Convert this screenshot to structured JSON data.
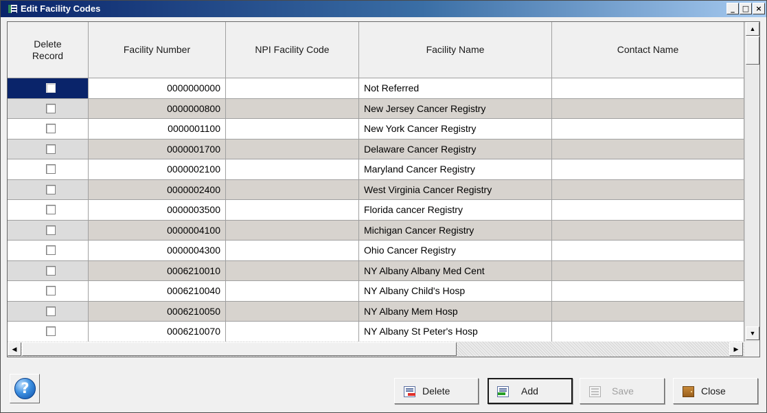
{
  "window": {
    "title": "Edit Facility Codes",
    "min": "_",
    "max": "□",
    "close": "×"
  },
  "grid": {
    "columns": [
      "Delete\nRecord",
      "Facility Number",
      "NPI Facility Code",
      "Facility Name",
      "Contact Name"
    ],
    "rows": [
      {
        "number": "0000000000",
        "npi": "",
        "name": "Not Referred",
        "contact": ""
      },
      {
        "number": "0000000800",
        "npi": "",
        "name": "New Jersey Cancer Registry",
        "contact": ""
      },
      {
        "number": "0000001100",
        "npi": "",
        "name": "New York Cancer Registry",
        "contact": ""
      },
      {
        "number": "0000001700",
        "npi": "",
        "name": "Delaware Cancer Registry",
        "contact": ""
      },
      {
        "number": "0000002100",
        "npi": "",
        "name": "Maryland Cancer Registry",
        "contact": ""
      },
      {
        "number": "0000002400",
        "npi": "",
        "name": "West Virginia Cancer Registry",
        "contact": ""
      },
      {
        "number": "0000003500",
        "npi": "",
        "name": "Florida cancer Registry",
        "contact": ""
      },
      {
        "number": "0000004100",
        "npi": "",
        "name": "Michigan Cancer Registry",
        "contact": ""
      },
      {
        "number": "0000004300",
        "npi": "",
        "name": "Ohio Cancer Registry",
        "contact": ""
      },
      {
        "number": "0006210010",
        "npi": "",
        "name": "NY Albany Albany Med Cent",
        "contact": ""
      },
      {
        "number": "0006210040",
        "npi": "",
        "name": "NY Albany Child's Hosp",
        "contact": ""
      },
      {
        "number": "0006210050",
        "npi": "",
        "name": "NY Albany Mem Hosp",
        "contact": ""
      },
      {
        "number": "0006210070",
        "npi": "",
        "name": "NY Albany St Peter's Hosp",
        "contact": ""
      }
    ]
  },
  "buttons": {
    "delete": "Delete",
    "add": "Add",
    "save": "Save",
    "close": "Close",
    "help": "?"
  },
  "colors": {
    "title_start": "#0a246a",
    "title_end": "#a6caf0",
    "row_alt": "#d7d3ce",
    "selection": "#0a246a"
  }
}
